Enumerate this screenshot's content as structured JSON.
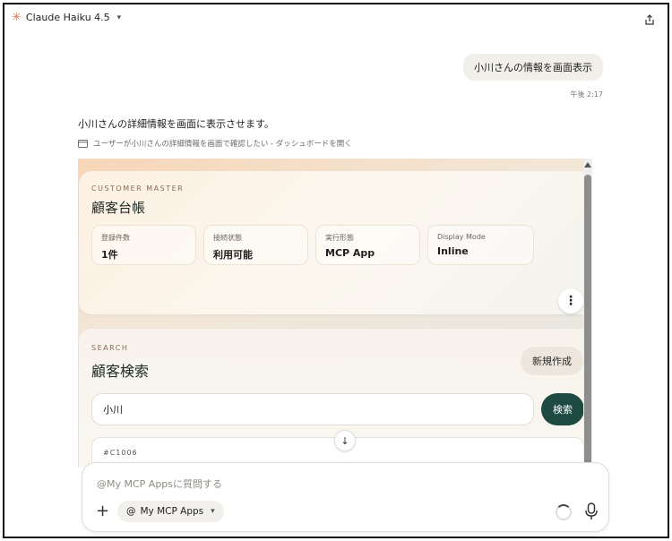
{
  "header": {
    "model_name": "Claude Haiku 4.5"
  },
  "chat": {
    "user_message": "小川さんの情報を画面表示",
    "timestamp": "午後 2:17",
    "assistant_message": "小川さんの詳細情報を画面に表示させます。",
    "tool_call": "ユーザーが小川さんの詳細情報を画面で確認したい - ダッシュボードを開く"
  },
  "app": {
    "master": {
      "eyebrow": "CUSTOMER MASTER",
      "title": "顧客台帳",
      "stats": [
        {
          "label": "登録件数",
          "value": "1件"
        },
        {
          "label": "接続状態",
          "value": "利用可能"
        },
        {
          "label": "実行形態",
          "value": "MCP App"
        },
        {
          "label": "Display Mode",
          "value": "Inline"
        }
      ]
    },
    "search": {
      "eyebrow": "SEARCH",
      "title": "顧客検索",
      "new_button": "新規作成",
      "query": "小川",
      "search_button": "検索",
      "first_result_id": "#C1006"
    }
  },
  "composer": {
    "placeholder": "@My MCP Appsに質問する",
    "chip_label": "My MCP Apps"
  },
  "colors": {
    "accent_dark_green": "#1f4a42",
    "claude_orange": "#d97757"
  }
}
